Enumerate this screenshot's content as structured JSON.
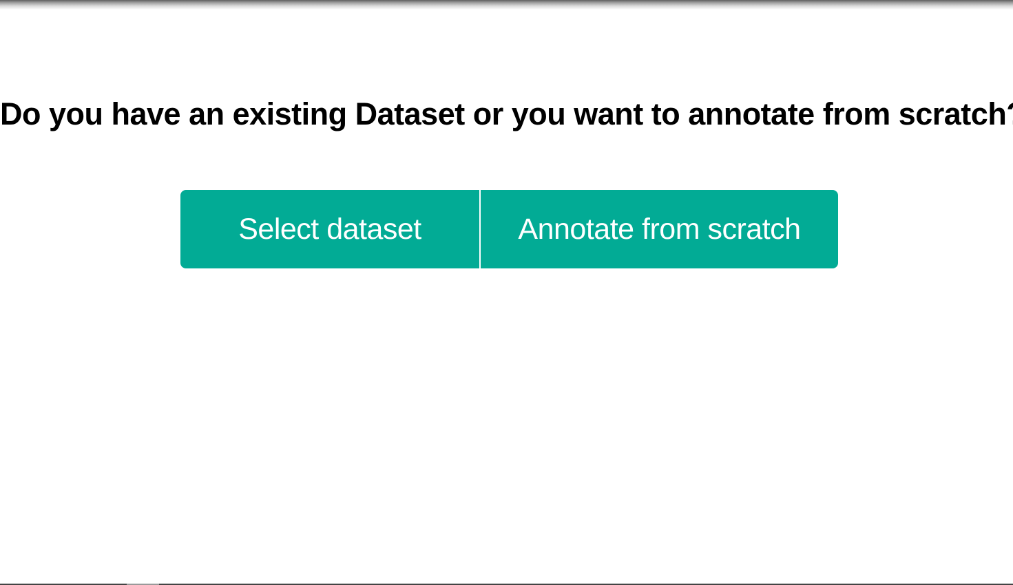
{
  "question": {
    "text": "Do you have an existing Dataset or you want to annotate from scratch?"
  },
  "actions": {
    "select_dataset": "Select dataset",
    "annotate_from_scratch": "Annotate from scratch"
  },
  "colors": {
    "primary": "#02ab95",
    "background": "#ffffff",
    "text": "#000000"
  }
}
